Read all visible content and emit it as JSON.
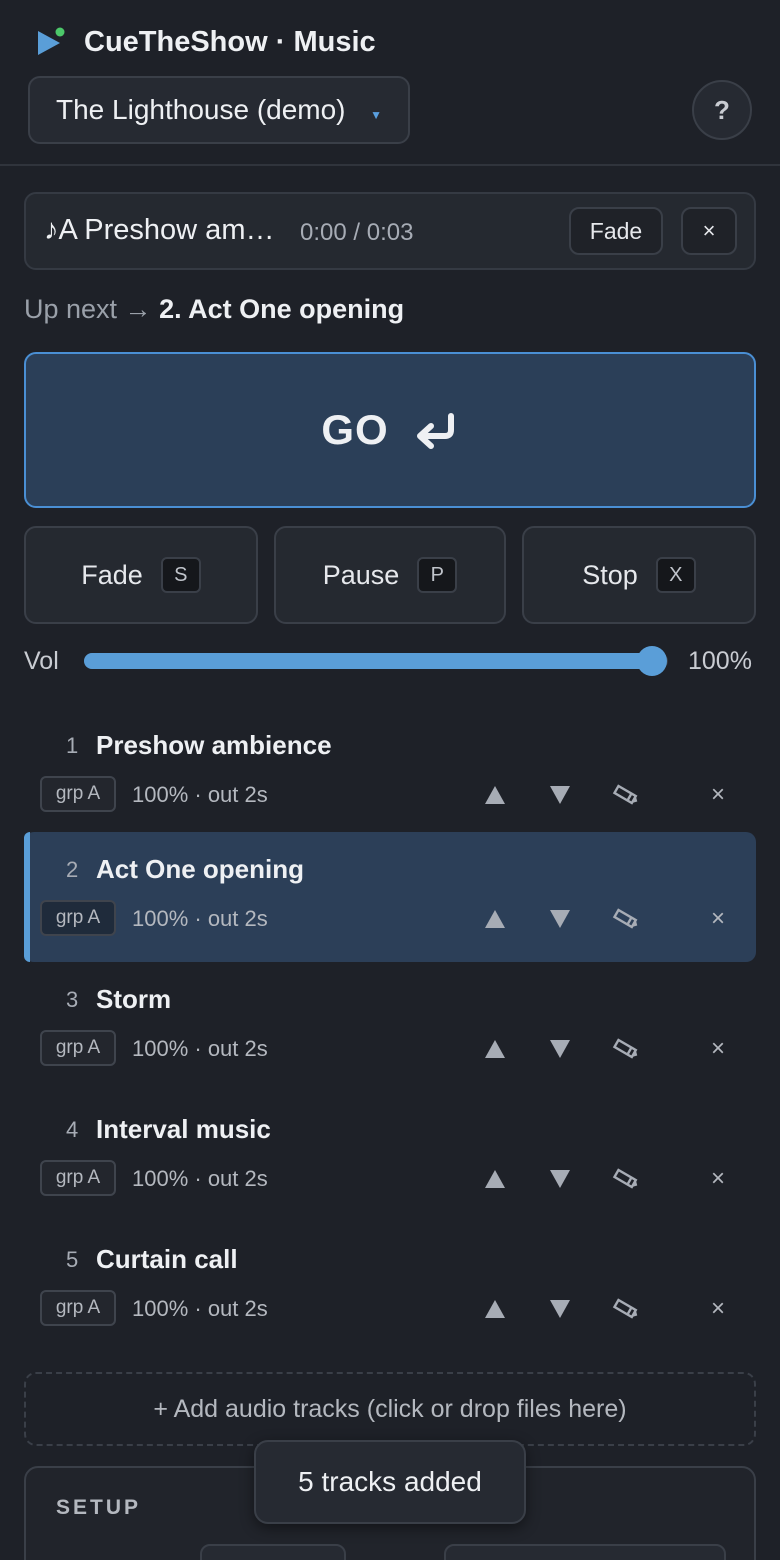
{
  "app": {
    "title": "CueTheShow · Music",
    "show_name": "The Lighthouse (demo)",
    "help_label": "?"
  },
  "now_playing": {
    "title": "♪A Preshow am…",
    "time": "0:00 / 0:03",
    "fade_label": "Fade",
    "close_label": "×"
  },
  "up_next": {
    "prefix": "Up next →",
    "cue": "2. Act One opening"
  },
  "go": {
    "label": "GO"
  },
  "controls": {
    "fade": {
      "label": "Fade",
      "key": "S"
    },
    "pause": {
      "label": "Pause",
      "key": "P"
    },
    "stop": {
      "label": "Stop",
      "key": "X"
    }
  },
  "volume": {
    "label": "Vol",
    "value_text": "100%",
    "level": 1.0
  },
  "cues": [
    {
      "num": "1",
      "name": "Preshow ambience",
      "group": "grp A",
      "meta": "100% · out 2s",
      "active": false
    },
    {
      "num": "2",
      "name": "Act One opening",
      "group": "grp A",
      "meta": "100% · out 2s",
      "active": true
    },
    {
      "num": "3",
      "name": "Storm",
      "group": "grp A",
      "meta": "100% · out 2s",
      "active": false
    },
    {
      "num": "4",
      "name": "Interval music",
      "group": "grp A",
      "meta": "100% · out 2s",
      "active": false
    },
    {
      "num": "5",
      "name": "Curtain call",
      "group": "grp A",
      "meta": "100% · out 2s",
      "active": false
    }
  ],
  "cue_delete_label": "×",
  "add_tracks_label": "+ Add audio tracks (click or drop files here)",
  "setup": {
    "title": "SETUP"
  },
  "toast": {
    "message": "5 tracks added"
  },
  "colors": {
    "accent": "#5a9ed8",
    "background": "#1e2128",
    "active_row": "#2c3f58",
    "logo_dot": "#4cc86a"
  }
}
